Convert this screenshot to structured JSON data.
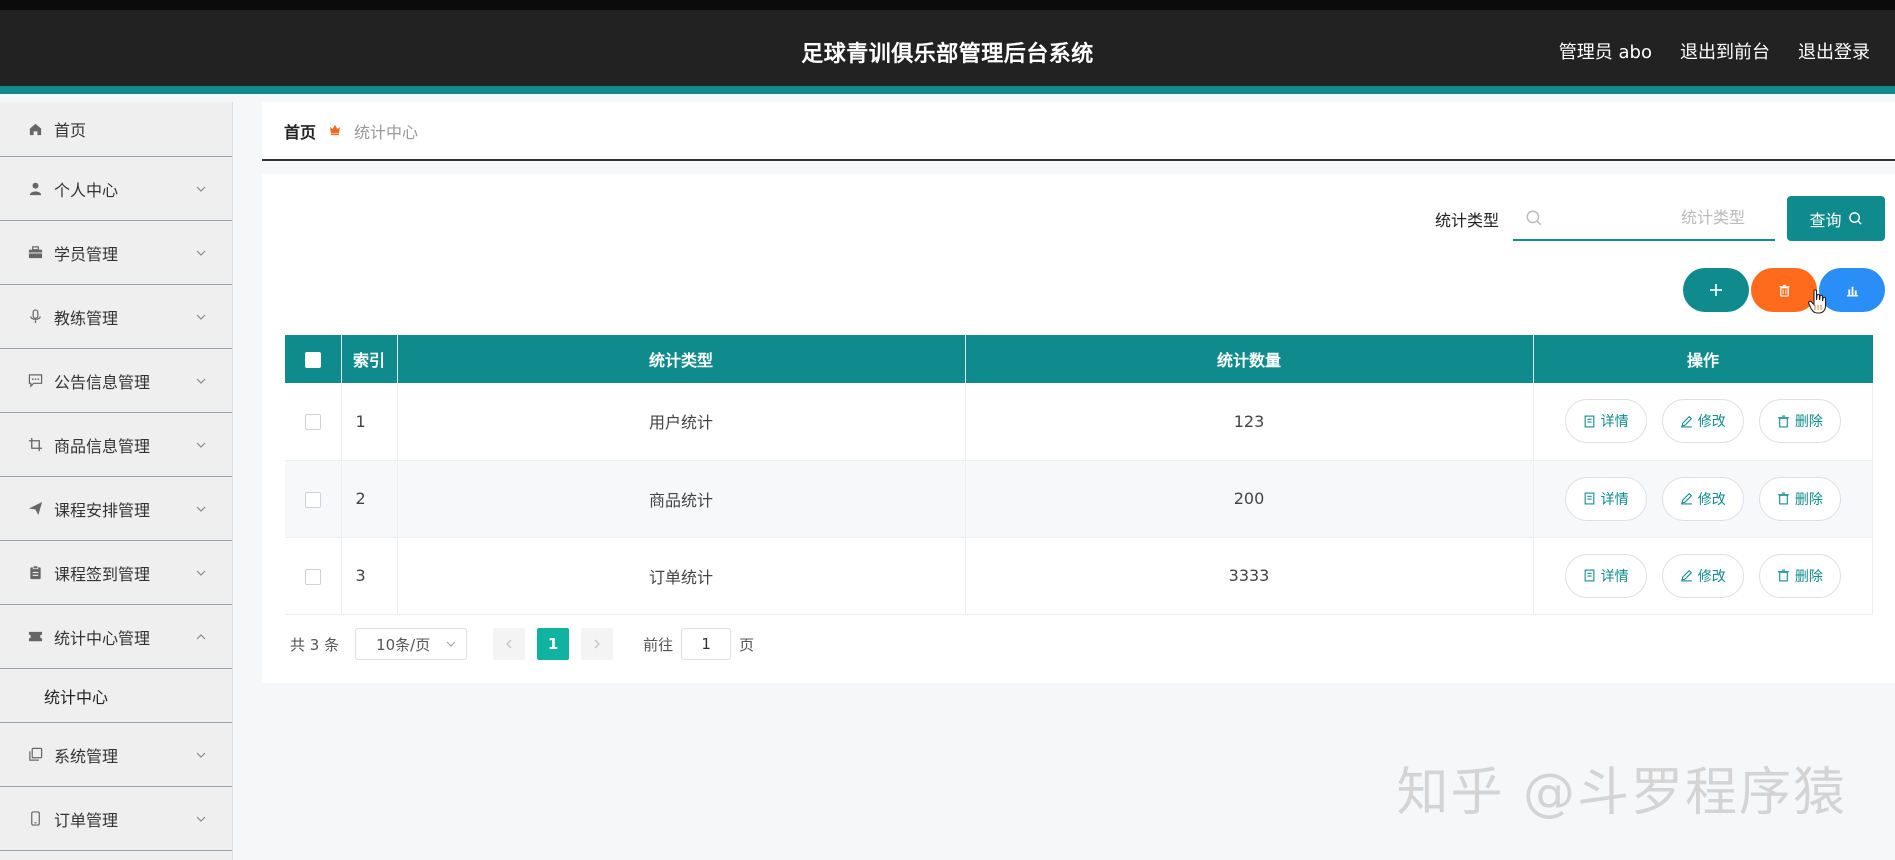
{
  "header": {
    "title": "足球青训俱乐部管理后台系统",
    "user_label": "管理员 abo",
    "frontend_link": "退出到前台",
    "logout_link": "退出登录"
  },
  "sidebar": {
    "items": [
      {
        "label": "首页",
        "icon": "home-icon"
      },
      {
        "label": "个人中心",
        "icon": "user-icon"
      },
      {
        "label": "学员管理",
        "icon": "briefcase-icon"
      },
      {
        "label": "教练管理",
        "icon": "microphone-icon"
      },
      {
        "label": "公告信息管理",
        "icon": "message-icon"
      },
      {
        "label": "商品信息管理",
        "icon": "crop-icon"
      },
      {
        "label": "课程安排管理",
        "icon": "send-icon"
      },
      {
        "label": "课程签到管理",
        "icon": "clipboard-icon"
      },
      {
        "label": "统计中心管理",
        "icon": "ticket-icon"
      },
      {
        "label": "系统管理",
        "icon": "copy-icon"
      },
      {
        "label": "订单管理",
        "icon": "phone-icon"
      }
    ],
    "submenu": {
      "label": "统计中心"
    }
  },
  "breadcrumb": {
    "home": "首页",
    "current": "统计中心"
  },
  "search": {
    "label": "统计类型",
    "placeholder": "统计类型",
    "button": "查询"
  },
  "table": {
    "headers": [
      "索引",
      "统计类型",
      "统计数量",
      "操作"
    ],
    "rows": [
      {
        "index": "1",
        "type": "用户统计",
        "count": "123"
      },
      {
        "index": "2",
        "type": "商品统计",
        "count": "200"
      },
      {
        "index": "3",
        "type": "订单统计",
        "count": "3333"
      }
    ],
    "actions": {
      "detail": "详情",
      "edit": "修改",
      "delete": "删除"
    }
  },
  "pagination": {
    "total": "共 3 条",
    "page_size": "10条/页",
    "current_page": "1",
    "goto_label": "前往",
    "goto_value": "1",
    "page_suffix": "页"
  },
  "watermark": "知乎 @斗罗程序猿",
  "colors": {
    "primary": "#0f8b8d",
    "danger": "#ff6b1c",
    "info": "#2a8ef7",
    "header_bg": "#222222"
  }
}
